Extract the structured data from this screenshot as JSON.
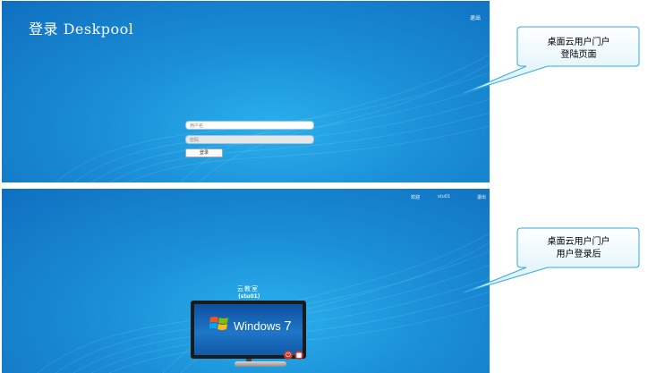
{
  "login_page": {
    "logo": "登录 Deskpool",
    "exit_link": "退出",
    "username_placeholder": "用户名",
    "password_placeholder": "密码",
    "login_button": "登录"
  },
  "portal_page": {
    "topbar": {
      "welcome": "欢迎",
      "username": "stu01",
      "logout": "退出"
    },
    "vm_name": "云教室",
    "vm_user": "(stu01)",
    "screen_brand": "Windows",
    "screen_version": "7",
    "controls": {
      "power_icon": "power-icon",
      "stop_icon": "stop-icon"
    }
  },
  "callouts": {
    "first": {
      "line1": "桌面云用户门户",
      "line2": "登陆页面"
    },
    "second": {
      "line1": "桌面云用户门户",
      "line2": "用户登录后"
    }
  },
  "colors": {
    "panel_blue": "#1a8ed6",
    "callout_fill": "#e8f7fd",
    "callout_border": "#33aadd"
  }
}
